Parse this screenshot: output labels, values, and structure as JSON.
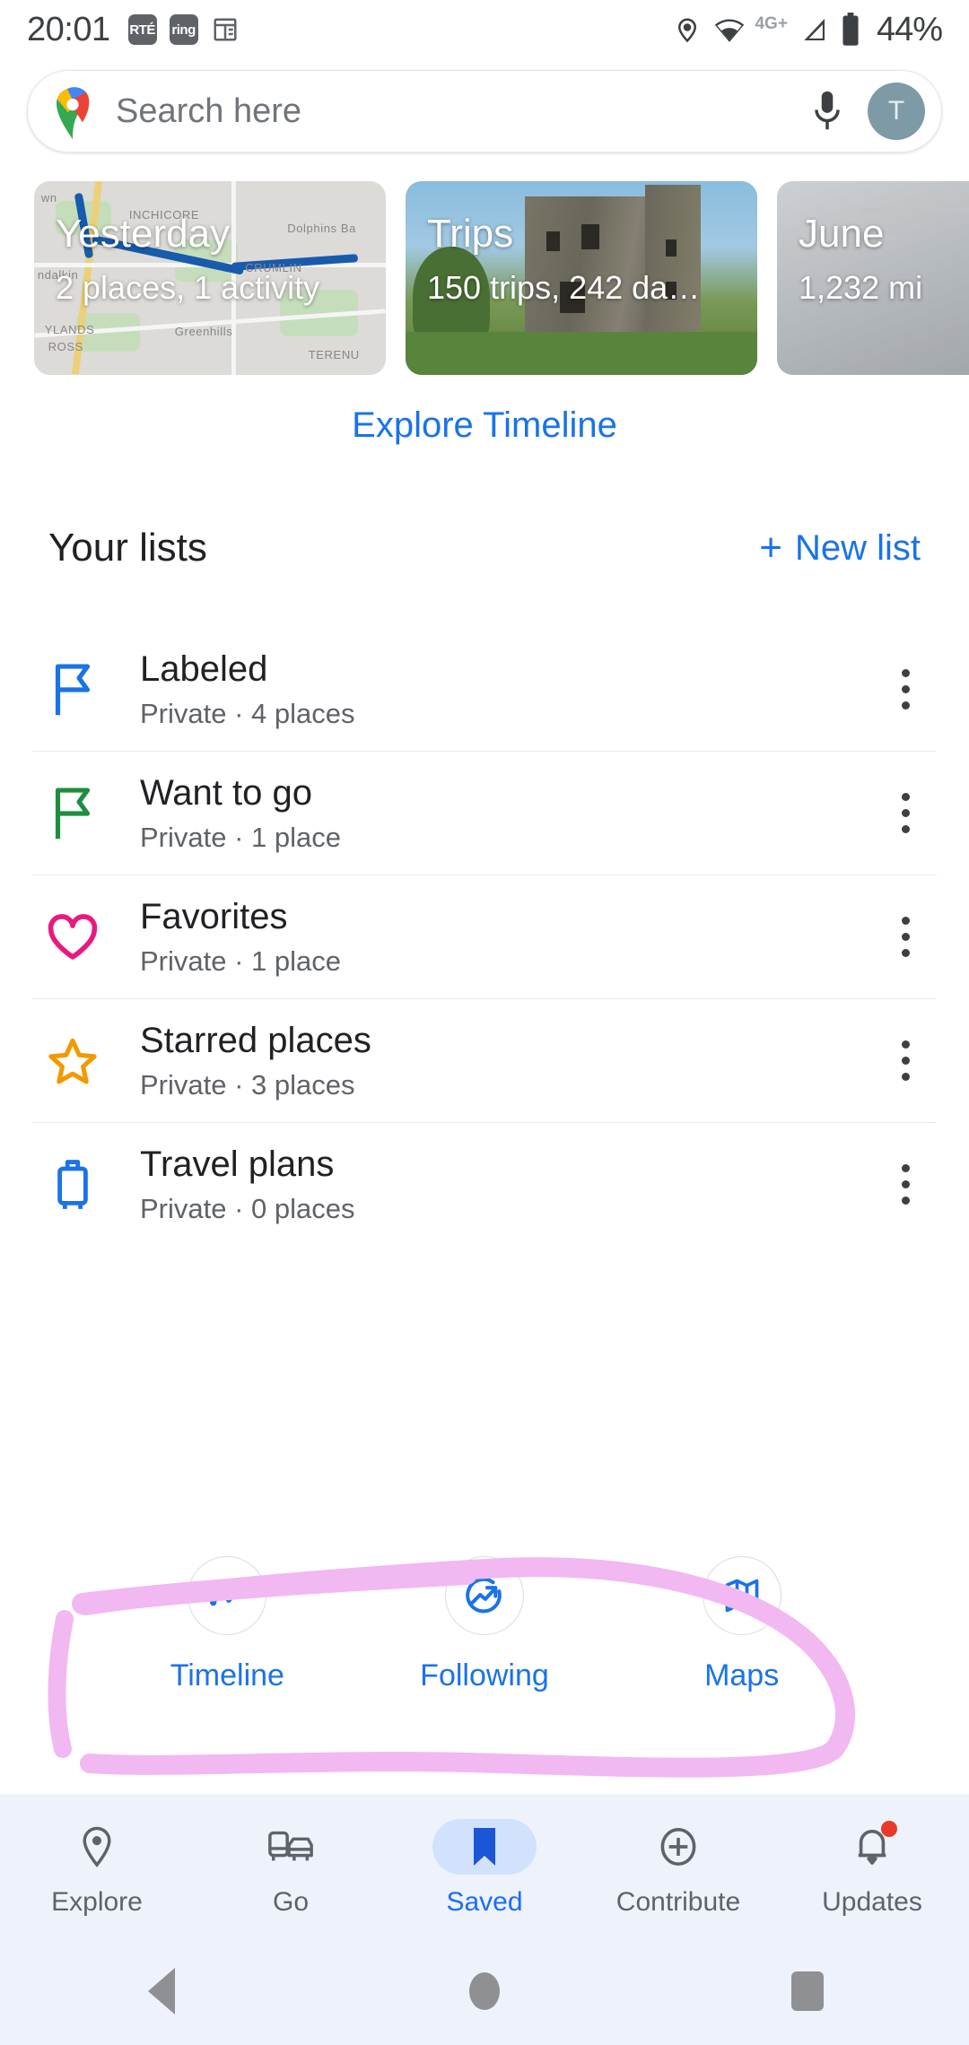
{
  "status_bar": {
    "time": "20:01",
    "left_icons": [
      {
        "name": "rte-notification-icon",
        "label": "RTÉ"
      },
      {
        "name": "ring-notification-icon",
        "label": "ring"
      },
      {
        "name": "calendar-notification-icon",
        "label": ""
      }
    ],
    "location_icon": "location-pin-icon",
    "wifi_icon": "wifi-icon",
    "network_type": "4G+",
    "signal_icon": "cellular-signal-icon",
    "battery_icon": "battery-icon",
    "battery_percent": "44%"
  },
  "search": {
    "placeholder": "Search here",
    "maps_logo": "google-maps-logo-icon",
    "mic_icon": "microphone-icon",
    "avatar_initial": "T"
  },
  "timeline_cards": [
    {
      "title": "Yesterday",
      "subtitle": "2 places,  1 activity",
      "thumb": "map"
    },
    {
      "title": "Trips",
      "subtitle": "150 trips,  242 da…",
      "thumb": "photo"
    },
    {
      "title": "June",
      "subtitle": "1,232 mi",
      "thumb": "grey"
    }
  ],
  "explore_timeline_label": "Explore Timeline",
  "lists_header": {
    "title": "Your lists",
    "new_list_plus": "+",
    "new_list_label": "New list"
  },
  "lists": [
    {
      "name": "Labeled",
      "meta": "Private · 4 places",
      "icon": "flag-outline-icon",
      "color": "#1a73e8"
    },
    {
      "name": "Want to go",
      "meta": "Private · 1 place",
      "icon": "flag-icon",
      "color": "#1e8e3e"
    },
    {
      "name": "Favorites",
      "meta": "Private · 1 place",
      "icon": "heart-icon",
      "color": "#e8197f"
    },
    {
      "name": "Starred places",
      "meta": "Private · 3 places",
      "icon": "star-icon",
      "color": "#f29900"
    },
    {
      "name": "Travel plans",
      "meta": "Private · 0 places",
      "icon": "suitcase-icon",
      "color": "#1a73e8"
    }
  ],
  "list_row_menu_icon": "kebab-menu-icon",
  "quick_actions": [
    {
      "label": "Timeline",
      "icon": "line-chart-icon"
    },
    {
      "label": "Following",
      "icon": "trending-circle-icon"
    },
    {
      "label": "Maps",
      "icon": "folded-map-icon"
    }
  ],
  "annotation": {
    "shape": "hand-drawn-circle",
    "color": "#f2b8f2",
    "target": "quick-actions-row"
  },
  "bottom_nav": [
    {
      "label": "Explore",
      "icon": "location-pin-icon",
      "active": false,
      "badge": false
    },
    {
      "label": "Go",
      "icon": "commute-icon",
      "active": false,
      "badge": false
    },
    {
      "label": "Saved",
      "icon": "bookmark-icon",
      "active": true,
      "badge": false
    },
    {
      "label": "Contribute",
      "icon": "plus-circle-icon",
      "active": false,
      "badge": false
    },
    {
      "label": "Updates",
      "icon": "bell-icon",
      "active": false,
      "badge": true
    }
  ],
  "android_nav": [
    {
      "name": "back-button",
      "icon": "triangle-back-icon"
    },
    {
      "name": "home-button",
      "icon": "circle-home-icon"
    },
    {
      "name": "recents-button",
      "icon": "square-recents-icon"
    }
  ],
  "colors": {
    "accent_blue": "#1a73e8",
    "nav_background": "#eef2fb",
    "annotation_pink": "#f2b8f2"
  }
}
